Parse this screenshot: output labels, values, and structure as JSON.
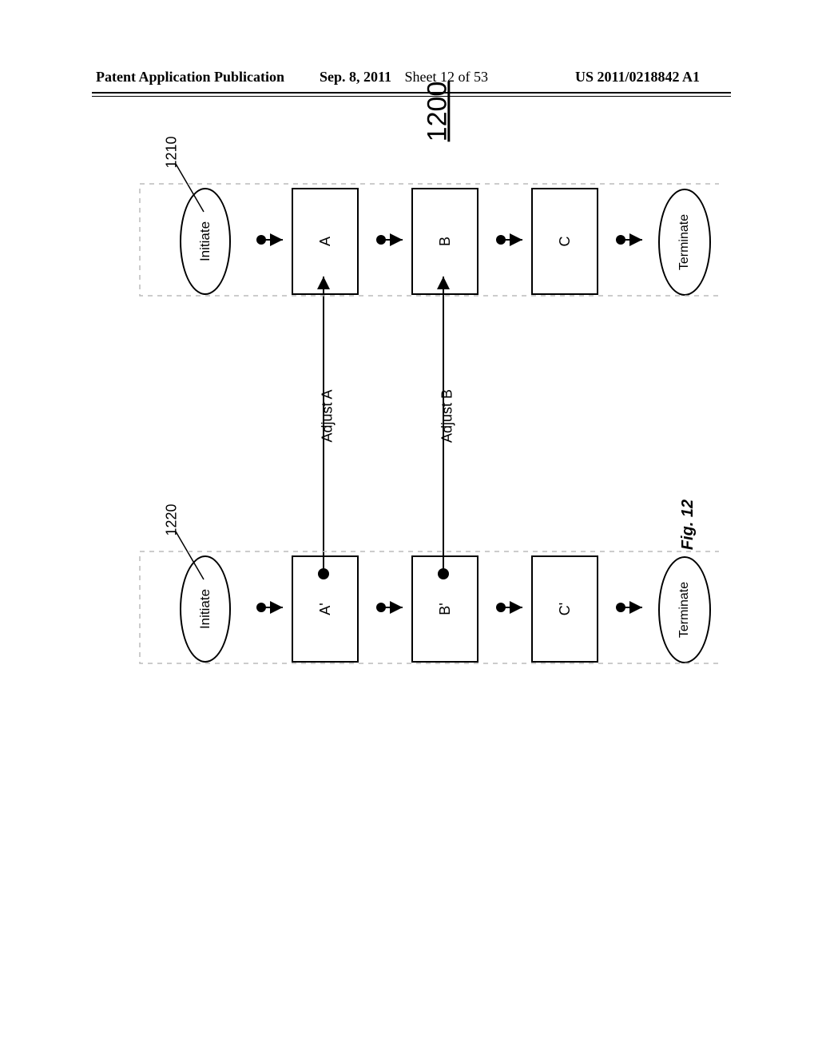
{
  "header": {
    "publication_label": "Patent Application Publication",
    "date": "Sep. 8, 2011",
    "sheet": "Sheet 12 of 53",
    "pub_number": "US 2011/0218842 A1"
  },
  "figure_number": "1200",
  "figure_label": "Fig. 12",
  "refs": {
    "left": "1210",
    "right": "1220"
  },
  "left_flow": {
    "initiate": "Initiate",
    "a": "A",
    "b": "B",
    "c": "C",
    "terminate": "Terminate"
  },
  "right_flow": {
    "initiate": "Initiate",
    "a": "A'",
    "b": "B'",
    "c": "C'",
    "terminate": "Terminate"
  },
  "adjust": {
    "a": "Adjust A",
    "b": "Adjust B"
  }
}
